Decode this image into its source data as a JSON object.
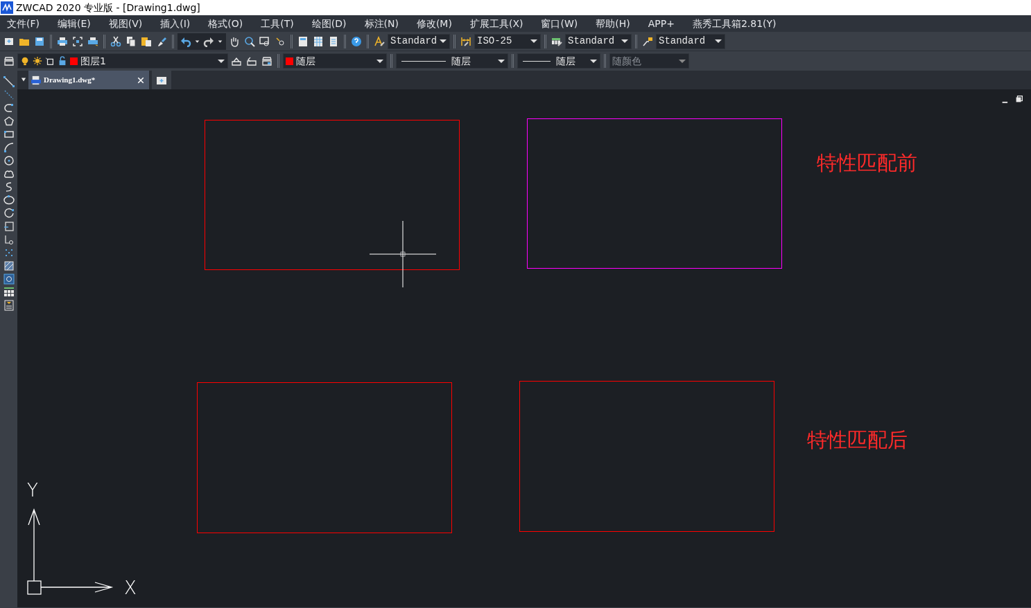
{
  "window": {
    "title": "ZWCAD 2020 专业版 - [Drawing1.dwg]"
  },
  "menu": [
    "文件(F)",
    "编辑(E)",
    "视图(V)",
    "插入(I)",
    "格式(O)",
    "工具(T)",
    "绘图(D)",
    "标注(N)",
    "修改(M)",
    "扩展工具(X)",
    "窗口(W)",
    "帮助(H)",
    "APP+",
    "燕秀工具箱2.81(Y)"
  ],
  "style_dropdowns": [
    {
      "kind": "text",
      "value": "Standard"
    },
    {
      "kind": "dimension",
      "value": "ISO-25"
    },
    {
      "kind": "table",
      "value": "Standard"
    },
    {
      "kind": "multileader",
      "value": "Standard"
    }
  ],
  "layer_bar": {
    "layer": {
      "value": "图层1",
      "color": "#ff0000"
    },
    "properties": [
      {
        "kind": "color",
        "value": "随层",
        "color": "#ff0000",
        "disabled": false
      },
      {
        "kind": "linetype",
        "value": "随层",
        "disabled": false
      },
      {
        "kind": "lineweight",
        "value": "随层",
        "disabled": false
      },
      {
        "kind": "plotstyle",
        "value": "随颜色",
        "disabled": true
      }
    ]
  },
  "tabs": [
    {
      "label": "Drawing1.dwg*",
      "selected": true
    }
  ],
  "drawing": {
    "rectangles": [
      {
        "color": "#ff0000"
      },
      {
        "color": "#ff00ff"
      },
      {
        "color": "#ff0000"
      },
      {
        "color": "#ff0000"
      }
    ],
    "labels": [
      {
        "text": "特性匹配前",
        "color": "#ff2a2a"
      },
      {
        "text": "特性匹配后",
        "color": "#ff2a2a"
      }
    ],
    "ucs": {
      "x_label": "X",
      "y_label": "Y"
    }
  }
}
